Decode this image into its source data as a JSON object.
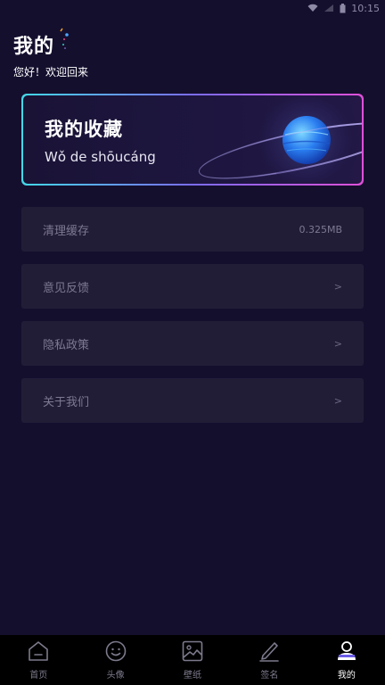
{
  "status_bar": {
    "time": "10:15"
  },
  "header": {
    "title": "我的",
    "greeting": "您好！欢迎回来"
  },
  "favorites_card": {
    "title": "我的收藏",
    "subtitle": "Wǒ de shōucáng"
  },
  "menu": [
    {
      "label": "清理缓存",
      "value": "0.325MB"
    },
    {
      "label": "意见反馈",
      "arrow": ">"
    },
    {
      "label": "隐私政策",
      "arrow": ">"
    },
    {
      "label": "关于我们",
      "arrow": ">"
    }
  ],
  "bottom_nav": [
    {
      "label": "首页",
      "icon": "home-icon"
    },
    {
      "label": "头像",
      "icon": "smiley-icon"
    },
    {
      "label": "壁纸",
      "icon": "image-icon"
    },
    {
      "label": "签名",
      "icon": "pen-icon"
    },
    {
      "label": "我的",
      "icon": "user-icon",
      "active": true
    }
  ],
  "colors": {
    "background": "#150f2e",
    "card_border_start": "#43d9e8",
    "card_border_end": "#e050d8",
    "menu_bg": "#221d37",
    "nav_bg": "#000000"
  }
}
